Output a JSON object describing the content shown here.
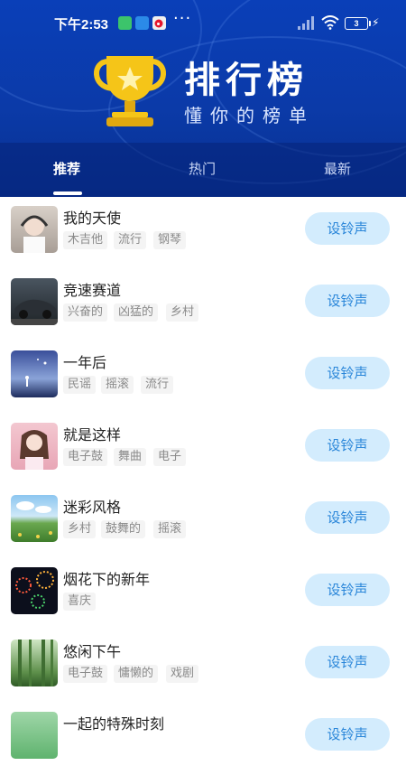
{
  "status": {
    "time": "下午2:53",
    "dots": "···",
    "battery": "3",
    "icons": [
      "app-green-icon",
      "app-blue-icon",
      "weibo-icon",
      "signal-icon",
      "wifi-icon",
      "battery-icon",
      "charging-icon"
    ]
  },
  "header": {
    "title": "排行榜",
    "subtitle": "懂你的榜单",
    "icon": "trophy-icon"
  },
  "tabs": [
    {
      "label": "推荐",
      "active": true
    },
    {
      "label": "热门",
      "active": false
    },
    {
      "label": "最新",
      "active": false
    }
  ],
  "songs": [
    {
      "title": "我的天使",
      "tags": [
        "木吉他",
        "流行",
        "钢琴"
      ],
      "button": "设铃声"
    },
    {
      "title": "竞速赛道",
      "tags": [
        "兴奋的",
        "凶猛的",
        "乡村"
      ],
      "button": "设铃声"
    },
    {
      "title": "一年后",
      "tags": [
        "民谣",
        "摇滚",
        "流行"
      ],
      "button": "设铃声"
    },
    {
      "title": "就是这样",
      "tags": [
        "电子鼓",
        "舞曲",
        "电子"
      ],
      "button": "设铃声"
    },
    {
      "title": "迷彩风格",
      "tags": [
        "乡村",
        "鼓舞的",
        "摇滚"
      ],
      "button": "设铃声"
    },
    {
      "title": "烟花下的新年",
      "tags": [
        "喜庆"
      ],
      "button": "设铃声"
    },
    {
      "title": "悠闲下午",
      "tags": [
        "电子鼓",
        "慵懒的",
        "戏剧"
      ],
      "button": "设铃声"
    },
    {
      "title": "一起的特殊时刻",
      "tags": [],
      "button": "设铃声"
    }
  ],
  "colors": {
    "header_bg": "#0a3fb8",
    "button_bg": "#d3ecfd",
    "button_text": "#2a86d9",
    "trophy": "#f5c518"
  }
}
